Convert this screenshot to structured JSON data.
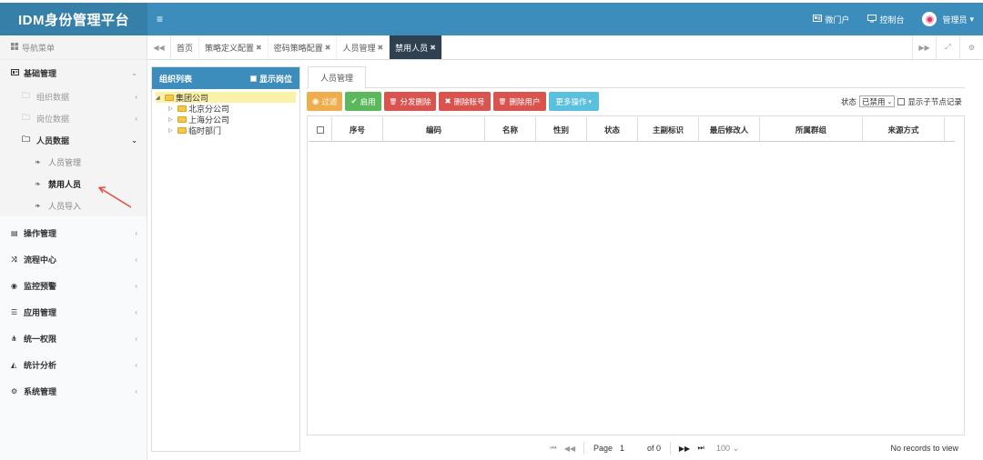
{
  "app": {
    "title": "IDM身份管理平台",
    "menu_toggle_glyph": "≡",
    "top_links": [
      {
        "icon": "id-card-icon",
        "label": "微门户"
      },
      {
        "icon": "monitor-icon",
        "label": "控制台"
      }
    ],
    "user": {
      "label": "管理员",
      "caret": "▾"
    }
  },
  "sidebar": {
    "header": "导航菜单",
    "groups": [
      {
        "label": "基础管理",
        "icon": "card-icon",
        "expanded": true
      },
      {
        "label": "操作管理",
        "icon": "book-icon"
      },
      {
        "label": "流程中心",
        "icon": "shuffle-icon"
      },
      {
        "label": "监控预警",
        "icon": "eye-icon"
      },
      {
        "label": "应用管理",
        "icon": "list-icon"
      },
      {
        "label": "统一权限",
        "icon": "sitemap-icon"
      },
      {
        "label": "统计分析",
        "icon": "area-chart-icon"
      },
      {
        "label": "系统管理",
        "icon": "cogs-icon"
      }
    ],
    "sub_items": [
      {
        "label": "组织数据"
      },
      {
        "label": "岗位数据"
      },
      {
        "label": "人员数据"
      }
    ],
    "leaf_items": [
      {
        "label": "人员管理"
      },
      {
        "label": "禁用人员"
      },
      {
        "label": "人员导入"
      }
    ]
  },
  "tabs": [
    {
      "label": "首页",
      "closable": false
    },
    {
      "label": "策略定义配置",
      "closable": true
    },
    {
      "label": "密码策略配置",
      "closable": true
    },
    {
      "label": "人员管理",
      "closable": true
    },
    {
      "label": "禁用人员",
      "closable": true,
      "active": true
    }
  ],
  "org_panel": {
    "title": "组织列表",
    "show_position_label": "显示岗位",
    "tree": {
      "root": "集团公司",
      "children": [
        "北京分公司",
        "上海分公司",
        "临时部门"
      ]
    }
  },
  "main": {
    "tab_label": "人员管理",
    "buttons": [
      {
        "label": "过滤",
        "glyph": "◉"
      },
      {
        "label": "启用",
        "glyph": "✔"
      },
      {
        "label": "分发删除",
        "glyph": "🗑"
      },
      {
        "label": "删除账号",
        "glyph": "✖"
      },
      {
        "label": "删除用户",
        "glyph": "🗑"
      },
      {
        "label": "更多操作",
        "glyph": "▾"
      }
    ],
    "filter": {
      "status_label": "状态",
      "status_value": "已禁用",
      "show_child_label": "显示子节点记录"
    },
    "columns": [
      "序号",
      "编码",
      "名称",
      "性别",
      "状态",
      "主副标识",
      "最后修改人",
      "所属群组",
      "来源方式"
    ],
    "pager": {
      "page_label": "Page",
      "page_value": "1",
      "of_label": "of 0",
      "page_size": "100",
      "empty_text": "No records to view"
    }
  },
  "colors": {
    "header_blue": "#3c8dbc",
    "logo_blue": "#367fa9",
    "active_tab": "#2f4050",
    "warning": "#f0ad4e",
    "success": "#5cb85c",
    "danger": "#d9534f",
    "info": "#5bc0de",
    "annotation_arrow": "#e64a3c"
  }
}
